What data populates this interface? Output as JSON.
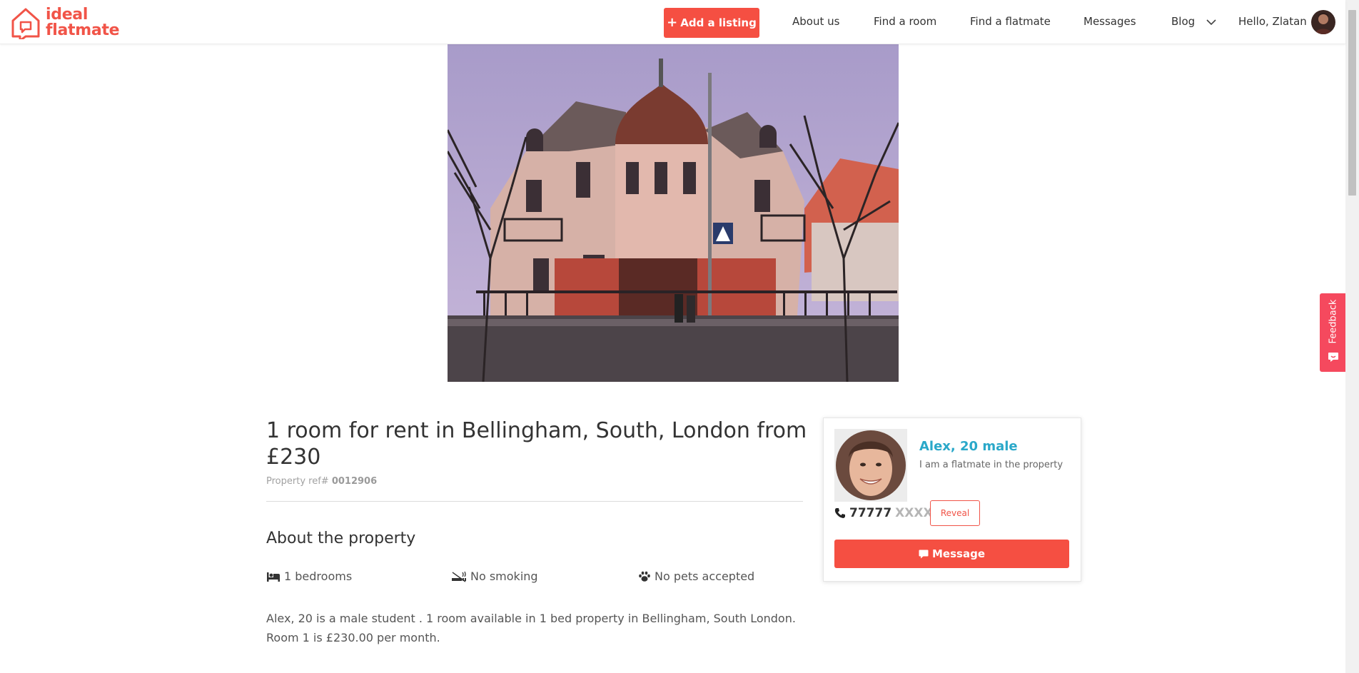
{
  "brand": {
    "logo_line1": "ideal",
    "logo_line2": "flatmate",
    "color": "#f15448"
  },
  "nav": {
    "add_listing_icon": "plus-icon",
    "add_listing_label": "Add a listing",
    "items": [
      {
        "label": "About us"
      },
      {
        "label": "Find a room"
      },
      {
        "label": "Find a flatmate"
      },
      {
        "label": "Messages"
      },
      {
        "label": "Blog",
        "icon": "chevron-down-icon"
      }
    ],
    "user_greeting": "Hello, Zlatan"
  },
  "hero": {
    "alt": "property-photo"
  },
  "listing": {
    "title": "1 room for rent in Bellingham, South, London from £230",
    "ref_label": "Property ref#",
    "ref_value": "0012906",
    "about_heading": "About the property",
    "features": [
      {
        "icon": "bed-icon",
        "label": "1 bedrooms"
      },
      {
        "icon": "no-smoking-icon",
        "label": "No smoking"
      },
      {
        "icon": "paw-icon",
        "label": "No pets accepted"
      }
    ],
    "description": "Alex, 20 is a male student . 1 room available in 1 bed property in Bellingham, South London. Room 1 is £230.00 per month."
  },
  "contact": {
    "name": "Alex, 20 male",
    "role": "I am a flatmate in the property",
    "phone_icon": "phone-icon",
    "phone_visible": "77777",
    "phone_masked": "XXXX",
    "reveal_label": "Reveal",
    "message_icon": "chat-icon",
    "message_label": "Message"
  },
  "feedback": {
    "label": "Feedback",
    "icon": "feedback-icon"
  },
  "colors": {
    "accent": "#f54f42",
    "link": "#2aa8c9",
    "feedback": "#f5495e"
  }
}
